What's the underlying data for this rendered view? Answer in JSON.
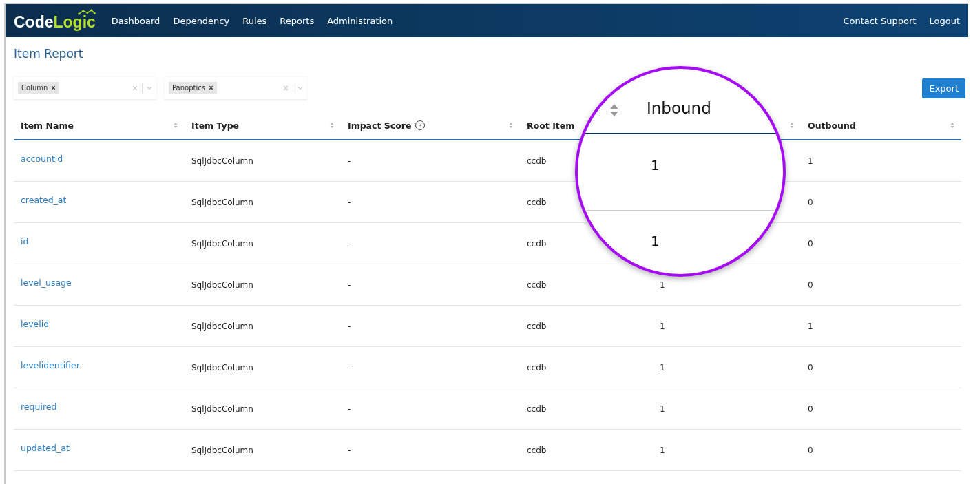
{
  "nav": {
    "logo": {
      "first": "Code",
      "second": "Logic"
    },
    "items": [
      "Dashboard",
      "Dependency",
      "Rules",
      "Reports",
      "Administration"
    ],
    "right_items": [
      "Contact Support",
      "Logout"
    ]
  },
  "page_title": "Item Report",
  "filters": [
    {
      "tag": "Column"
    },
    {
      "tag": "Panoptics"
    }
  ],
  "export_button": "Export",
  "table": {
    "columns": [
      {
        "label": "Item Name",
        "sort_icon": true
      },
      {
        "label": "Item Type",
        "sort_icon": true
      },
      {
        "label": "Impact Score",
        "help": "?",
        "sort_icon": true
      },
      {
        "label": "Root Item",
        "sort_icon": false
      },
      {
        "sort_icon": true
      },
      {
        "label": "Outbound",
        "sort_icon": true
      }
    ],
    "rows": [
      {
        "name": "accountid",
        "type": "SqlJdbcColumn",
        "impact": "-",
        "root": "ccdb",
        "outbound": "1"
      },
      {
        "name": "created_at",
        "type": "SqlJdbcColumn",
        "impact": "-",
        "root": "ccdb",
        "outbound": "0"
      },
      {
        "name": "id",
        "type": "SqlJdbcColumn",
        "impact": "-",
        "root": "ccdb",
        "outbound": "0"
      },
      {
        "name": "level_usage",
        "type": "SqlJdbcColumn",
        "impact": "-",
        "root": "ccdb",
        "inbound": "1",
        "outbound": "0"
      },
      {
        "name": "levelid",
        "type": "SqlJdbcColumn",
        "impact": "-",
        "root": "ccdb",
        "inbound": "1",
        "outbound": "1"
      },
      {
        "name": "levelidentifier",
        "type": "SqlJdbcColumn",
        "impact": "-",
        "root": "ccdb",
        "inbound": "1",
        "outbound": "0"
      },
      {
        "name": "required",
        "type": "SqlJdbcColumn",
        "impact": "-",
        "root": "ccdb",
        "inbound": "1",
        "outbound": "0"
      },
      {
        "name": "updated_at",
        "type": "SqlJdbcColumn",
        "impact": "-",
        "root": "ccdb",
        "inbound": "1",
        "outbound": "0"
      }
    ]
  },
  "magnifier": {
    "header": "Inbound",
    "values": [
      "1",
      "1"
    ]
  }
}
